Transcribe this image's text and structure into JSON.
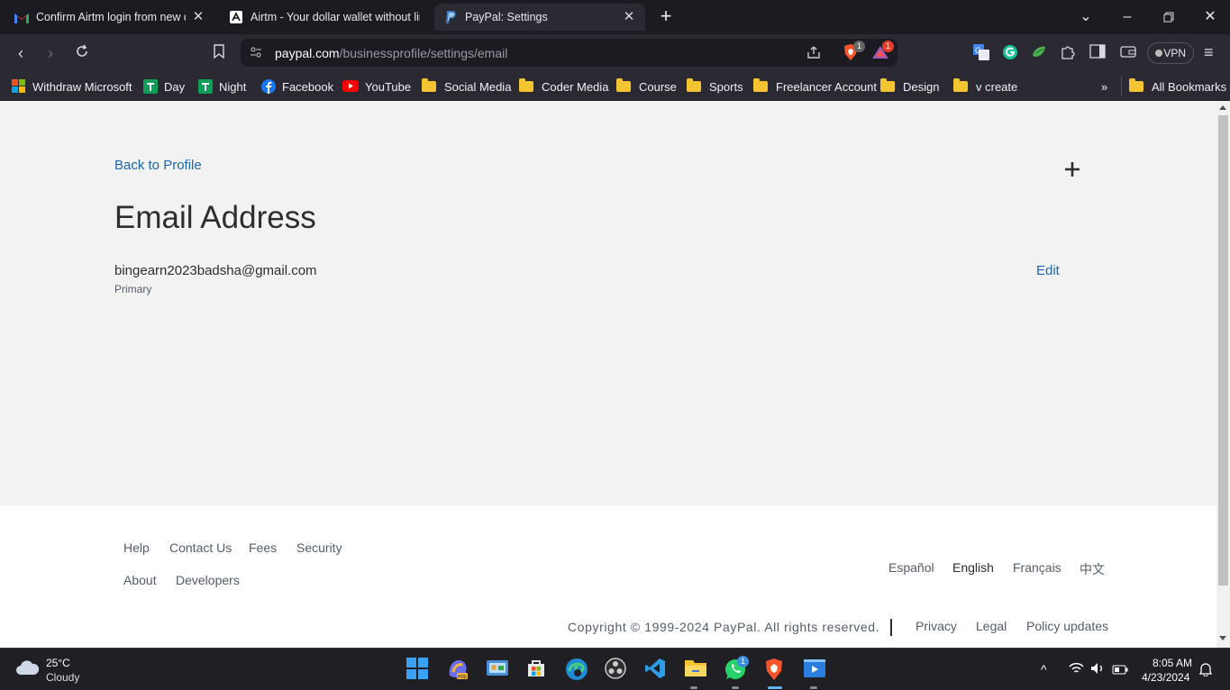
{
  "browser": {
    "tabs": [
      {
        "title": "Confirm Airtm login from new d",
        "icon": "gmail-icon"
      },
      {
        "title": "Airtm - Your dollar wallet without lim",
        "icon": "airtm-icon"
      },
      {
        "title": "PayPal: Settings",
        "icon": "paypal-icon"
      }
    ],
    "url_host": "paypal.com",
    "url_path": "/businessprofile/settings/email",
    "vpn_label": "VPN",
    "brave_shield_count": "1",
    "rewards_count": "1"
  },
  "bookmarks": [
    {
      "label": "Withdraw Microsoft",
      "icon": "microsoft-icon"
    },
    {
      "label": "Day",
      "icon": "sheets-icon"
    },
    {
      "label": "Night",
      "icon": "sheets-icon"
    },
    {
      "label": "Facebook",
      "icon": "facebook-icon"
    },
    {
      "label": "YouTube",
      "icon": "youtube-icon"
    },
    {
      "label": "Social Media",
      "icon": "folder-icon"
    },
    {
      "label": "Coder Media",
      "icon": "folder-icon"
    },
    {
      "label": "Course",
      "icon": "folder-icon"
    },
    {
      "label": "Sports",
      "icon": "folder-icon"
    },
    {
      "label": "Freelancer Account",
      "icon": "folder-icon"
    },
    {
      "label": "Design",
      "icon": "folder-icon"
    },
    {
      "label": "v create",
      "icon": "folder-icon"
    },
    {
      "label": "All Bookmarks",
      "icon": "folder-icon"
    }
  ],
  "page": {
    "back_link": "Back to Profile",
    "heading": "Email Address",
    "email": "bingearn2023badsha@gmail.com",
    "email_tag": "Primary",
    "edit_label": "Edit"
  },
  "footer": {
    "links_row1": [
      "Help",
      "Contact Us",
      "Fees",
      "Security"
    ],
    "links_row2": [
      "About",
      "Developers"
    ],
    "languages": [
      "Español",
      "English",
      "Français",
      "中文"
    ],
    "current_language": "English",
    "copyright": "Copyright © 1999-2024 PayPal. All rights reserved.",
    "legal_links": [
      "Privacy",
      "Legal",
      "Policy updates"
    ]
  },
  "taskbar": {
    "temperature": "25°C",
    "weather": "Cloudy",
    "time": "8:05 AM",
    "date": "4/23/2024",
    "whatsapp_badge": "1"
  },
  "colors": {
    "link": "#1b67b2",
    "text": "#2c2e2f",
    "muted": "#545d68",
    "page_bg": "#f2f2f2"
  }
}
